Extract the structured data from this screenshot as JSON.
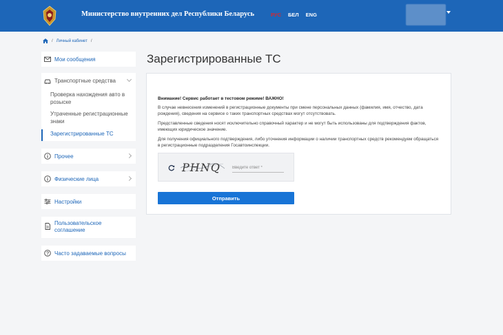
{
  "header": {
    "ministry_title": "Министерство внутренних дел Республики Беларусь",
    "languages": [
      "РУС",
      "БЕЛ",
      "ENG"
    ],
    "active_language": "РУС",
    "brand_color": "#1d66b8",
    "active_language_color": "#d9262b"
  },
  "breadcrumb": {
    "home_icon": "home-icon",
    "items": [
      "Личный кабинет"
    ]
  },
  "sidebar": {
    "messages": {
      "label": "Мои сообщения",
      "icon": "envelope-icon"
    },
    "vehicles": {
      "label": "Транспортные средства",
      "icon": "car-icon",
      "subitems": [
        "Проверка нахождения авто в розыске",
        "Утраченные регистрационные знаки",
        "Зарегистрированные ТС"
      ],
      "active_subitem": "Зарегистрированные ТС"
    },
    "other": {
      "label": "Прочее",
      "icon": "info-circle-icon"
    },
    "individuals": {
      "label": "Физические лица",
      "icon": "info-circle-icon"
    },
    "settings": {
      "label": "Настройки",
      "icon": "sliders-icon"
    },
    "agreement": {
      "label": "Пользовательское соглашение",
      "icon": "document-icon"
    },
    "faq": {
      "label": "Часто задаваемые вопросы",
      "icon": "question-circle-icon"
    }
  },
  "main": {
    "title": "Зарегистрированные ТС",
    "warning": "Внимание! Сервис работает в тестовом режиме! ВАЖНО!",
    "paragraphs": [
      "В случае невнесения изменений в регистрационные документы при смене персональных данных (фамилия, имя, отчество, дата рождения), сведения на сервисе о таких транспортных средствах могут отсутствовать.",
      "Представленные сведения носят исключительно справочный характер и не могут быть использованы для подтверждения фактов, имеющих юридическое значение.",
      "Для получения официального подтверждения, либо уточнения информации о наличии транспортных средств рекомендуем обращаться в регистрационные подразделения Госавтоинспекции."
    ],
    "captcha": {
      "text": "PHNQ",
      "placeholder": "Введите ответ *",
      "value": ""
    },
    "submit_label": "Отправить"
  }
}
